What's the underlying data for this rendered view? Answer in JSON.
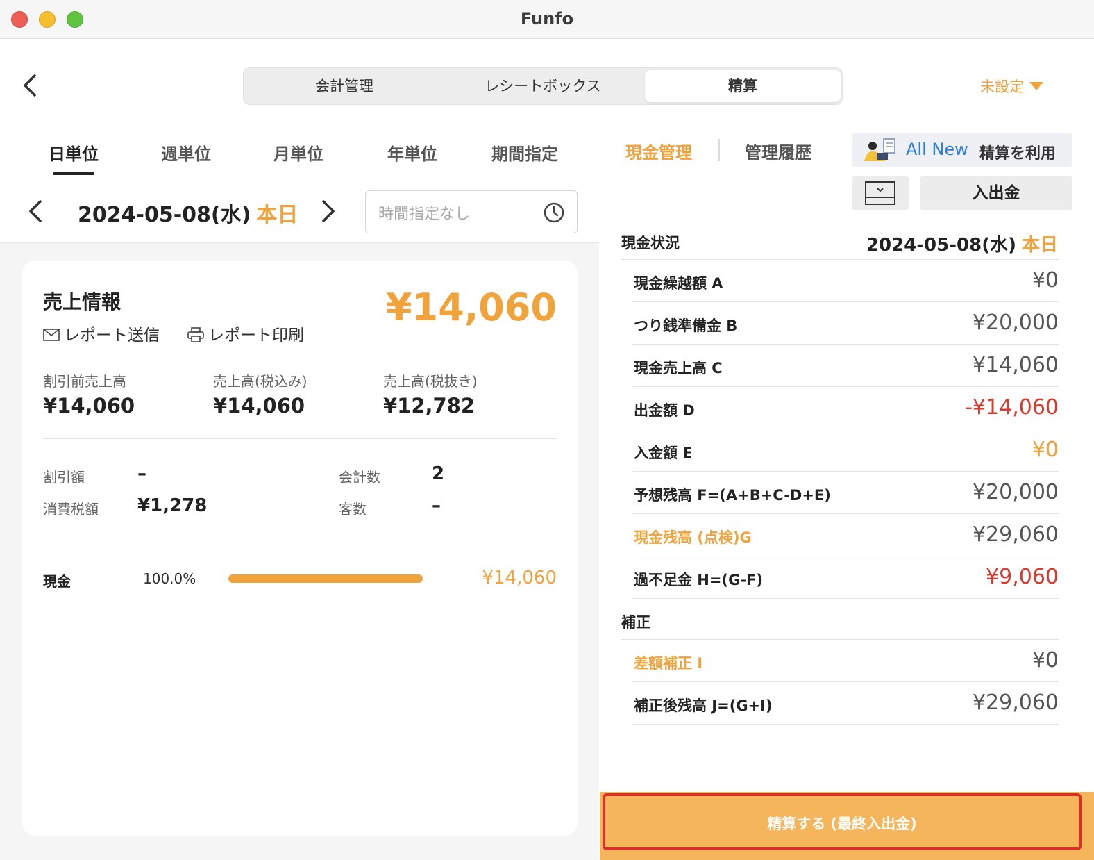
{
  "window": {
    "title": "Funfo"
  },
  "header": {
    "tabs": [
      {
        "label": "会計管理"
      },
      {
        "label": "レシートボックス"
      },
      {
        "label": "精算"
      }
    ],
    "store_select": "未設定"
  },
  "left": {
    "period_tabs": [
      {
        "label": "日単位"
      },
      {
        "label": "週単位"
      },
      {
        "label": "月単位"
      },
      {
        "label": "年単位"
      },
      {
        "label": "期間指定"
      }
    ],
    "date": "2024-05-08(水)",
    "today_label": "本日",
    "time_placeholder": "時間指定なし",
    "sales": {
      "title": "売上情報",
      "total": "¥14,060",
      "report_send": "レポート送信",
      "report_print": "レポート印刷",
      "stats": [
        {
          "label": "割引前売上高",
          "value": "¥14,060"
        },
        {
          "label": "売上高(税込み)",
          "value": "¥14,060"
        },
        {
          "label": "売上高(税抜き)",
          "value": "¥12,782"
        }
      ],
      "discount_label": "割引額",
      "discount_value": "–",
      "tax_label": "消費税額",
      "tax_value": "¥1,278",
      "count_label": "会計数",
      "count_value": "2",
      "guests_label": "客数",
      "guests_value": "–",
      "payment": {
        "label": "現金",
        "percent": "100.0%",
        "fraction": 1.0,
        "amount": "¥14,060"
      }
    }
  },
  "right": {
    "tabs": [
      {
        "label": "現金管理"
      },
      {
        "label": "管理履歴"
      }
    ],
    "allnew_prefix": "All New",
    "allnew_text": "精算を利用",
    "io_button": "入出金",
    "cash_status": {
      "title": "現金状況",
      "date": "2024-05-08(水)",
      "today": "本日",
      "rows": [
        {
          "label": "現金繰越額 A",
          "value": "¥0"
        },
        {
          "label": "つり銭準備金 B",
          "value": "¥20,000"
        },
        {
          "label": "現金売上高 C",
          "value": "¥14,060"
        },
        {
          "label": "出金額 D",
          "value": "-¥14,060"
        },
        {
          "label": "入金額 E",
          "value": "¥0"
        },
        {
          "label": "予想残高 F=(A+B+C-D+E)",
          "value": "¥20,000"
        },
        {
          "label": "現金残高 (点検)G",
          "value": "¥29,060"
        },
        {
          "label": "過不足金 H=(G-F)",
          "value": "¥9,060"
        }
      ]
    },
    "correction": {
      "title": "補正",
      "rows": [
        {
          "label": "差額補正 I",
          "value": "¥0"
        },
        {
          "label": "補正後残高 J=(G+I)",
          "value": "¥29,060"
        }
      ]
    },
    "settle_button": "精算する (最終入出金)"
  },
  "colors": {
    "accent": "#f0a23b",
    "negative": "#d83a2e",
    "link": "#2f7ee0"
  }
}
